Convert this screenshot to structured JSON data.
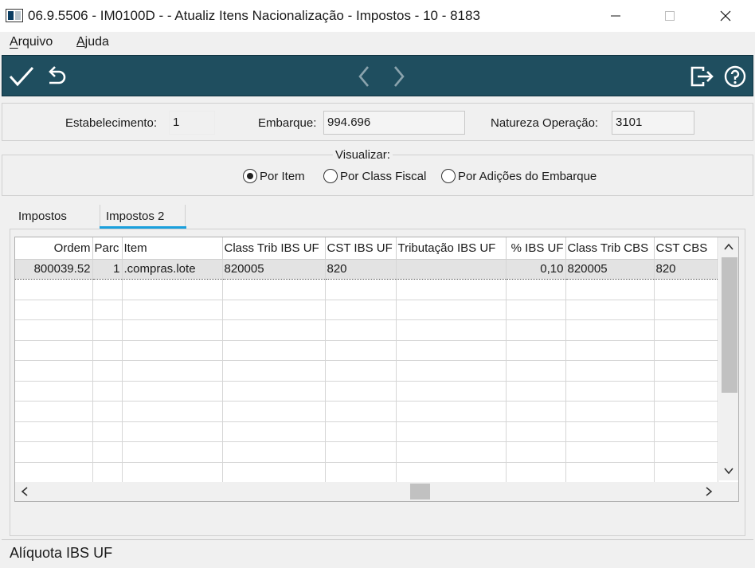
{
  "window": {
    "title": "06.9.5506 - IM0100D -  - Atualiz Itens Nacionalização - Impostos - 10 - 8183",
    "toolbar_bg": "#1f4e5f",
    "accent": "#1aa0dd"
  },
  "menu": {
    "arquivo": "Arquivo",
    "ajuda": "Ajuda"
  },
  "toolbar": {
    "icons": [
      "check-icon",
      "undo-icon",
      "chevron-left-icon",
      "chevron-right-icon",
      "exit-icon",
      "help-icon"
    ]
  },
  "header": {
    "estabelecimento_label": "Estabelecimento:",
    "estabelecimento_value": "1",
    "embarque_label": "Embarque:",
    "embarque_value": "994.696",
    "natureza_label": "Natureza Operação:",
    "natureza_value": "3101"
  },
  "visualizar": {
    "title": "Visualizar:",
    "options": [
      "Por Item",
      "Por Class Fiscal",
      "Por Adições do Embarque"
    ],
    "selected": "Por Item"
  },
  "tabs": [
    {
      "label": "Impostos",
      "active": false
    },
    {
      "label": "Impostos 2",
      "active": true
    }
  ],
  "grid": {
    "columns": [
      "Ordem",
      "Parc",
      "Item",
      "Class Trib IBS UF",
      "CST IBS UF",
      "Tributação IBS UF",
      "% IBS UF",
      "Class Trib CBS",
      "CST CBS"
    ],
    "rows": [
      [
        "800039.52",
        "1",
        ".compras.lote",
        "820005",
        "820",
        "",
        "0,10",
        "820005",
        "820"
      ]
    ]
  },
  "status": {
    "text": "Alíquota IBS UF"
  }
}
